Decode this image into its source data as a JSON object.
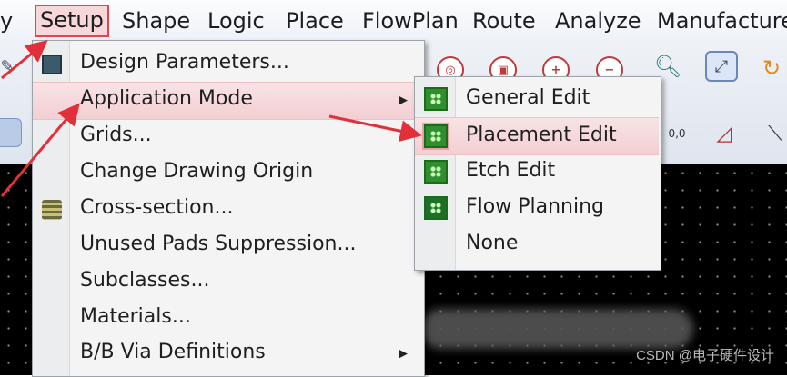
{
  "menubar": {
    "items": [
      {
        "label": "y"
      },
      {
        "label": "Setup"
      },
      {
        "label": "Shape"
      },
      {
        "label": "Logic"
      },
      {
        "label": "Place"
      },
      {
        "label": "FlowPlan"
      },
      {
        "label": "Route"
      },
      {
        "label": "Analyze"
      },
      {
        "label": "Manufacture"
      }
    ]
  },
  "setup_menu": {
    "items": [
      {
        "label": "Design Parameters..."
      },
      {
        "label": "Application Mode",
        "has_submenu": true
      },
      {
        "label": "Grids..."
      },
      {
        "label": "Change Drawing Origin"
      },
      {
        "label": "Cross-section..."
      },
      {
        "label": "Unused Pads Suppression..."
      },
      {
        "label": "Subclasses..."
      },
      {
        "label": "Materials..."
      },
      {
        "label": "B/B Via Definitions",
        "has_submenu": true
      }
    ],
    "highlighted": "Application Mode"
  },
  "application_mode_submenu": {
    "items": [
      {
        "label": "General Edit"
      },
      {
        "label": "Placement Edit"
      },
      {
        "label": "Etch Edit"
      },
      {
        "label": "Flow Planning"
      },
      {
        "label": "None"
      }
    ],
    "highlighted": "Placement Edit"
  },
  "watermark": "CSDN @电子硬件设计",
  "colors": {
    "highlight_bg": "#f2cfd3",
    "highlight_border": "#e0474c",
    "annotation_arrow": "#e0303a",
    "canvas_bg": "#000000",
    "mode_icon_green": "#2f8f2f"
  }
}
